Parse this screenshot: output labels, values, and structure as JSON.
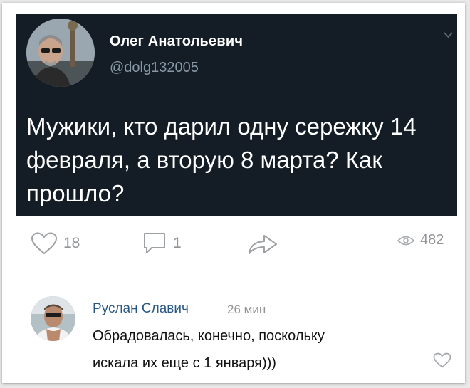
{
  "tweet": {
    "author_name": "Олег Анатольевич",
    "author_handle": "@dolg132005",
    "text": "Мужики, кто дарил одну сережку 14 февраля, а вторую 8 марта? Как прошло?"
  },
  "actions": {
    "likes": "18",
    "comments": "1",
    "views": "482"
  },
  "comment": {
    "author_name": "Руслан Славич",
    "time": "26 мин",
    "text_line1": "Обрадовалась, конечно, поскольку",
    "text_line2": "искала их еще с 1 января)))"
  },
  "colors": {
    "tweet_background": "#141d26",
    "handle": "#8899a6",
    "comment_author": "#2a5885",
    "icon_gray": "#909399"
  },
  "icons": [
    "heart-icon",
    "comment-icon",
    "share-icon",
    "eye-icon",
    "chevron-down-icon",
    "heart-outline-icon"
  ]
}
